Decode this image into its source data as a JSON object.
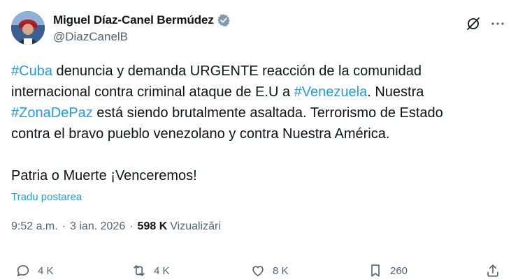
{
  "author": {
    "name": "Miguel Díaz-Canel Bermúdez",
    "handle": "@DiazCanelB"
  },
  "tweet": {
    "segments": [
      {
        "text": "#Cuba",
        "hashtag": true
      },
      {
        "text": " denuncia y demanda URGENTE reacción de la comunidad\ninternacional contra criminal ataque de E.U a ",
        "hashtag": false
      },
      {
        "text": "#Venezuela",
        "hashtag": true
      },
      {
        "text": ". Nuestra\n",
        "hashtag": false
      },
      {
        "text": "#ZonaDePaz",
        "hashtag": true
      },
      {
        "text": " está siendo brutalmente asaltada. Terrorismo de Estado\ncontra el bravo pueblo venezolano y contra Nuestra América.\n\nPatria o Muerte ¡Venceremos!",
        "hashtag": false
      }
    ],
    "translate_label": "Tradu postarea",
    "time": "9:52 a.m.",
    "separator": "·",
    "date": "3 ian. 2026",
    "views_count": "598 K",
    "views_label": "Vizualizări"
  },
  "actions": {
    "replies": "4 K",
    "reposts": "4 K",
    "likes": "8 K",
    "bookmarks": "260"
  },
  "icons": [
    "verified-badge-icon",
    "grok-icon",
    "more-icon",
    "reply-icon",
    "repost-icon",
    "like-icon",
    "bookmark-icon",
    "share-icon"
  ],
  "colors": {
    "accent": "#1d9bf0",
    "text": "#0f1419",
    "muted": "#536471"
  }
}
